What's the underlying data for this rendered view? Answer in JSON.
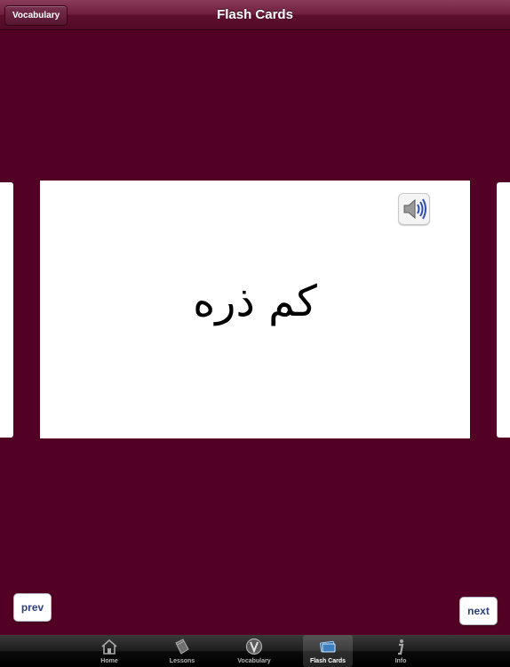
{
  "navbar": {
    "back_label": "Vocabulary",
    "title": "Flash Cards"
  },
  "card": {
    "word": "کم ذره",
    "speaker_icon": "speaker-icon"
  },
  "controls": {
    "prev_label": "prev",
    "next_label": "next"
  },
  "tabbar": {
    "tabs": [
      {
        "label": "Home",
        "icon": "home-icon",
        "selected": false
      },
      {
        "label": "Lessons",
        "icon": "book-icon",
        "selected": false
      },
      {
        "label": "Vocabulary",
        "icon": "vocabulary-icon",
        "selected": false
      },
      {
        "label": "Flash Cards",
        "icon": "flashcards-icon",
        "selected": true
      },
      {
        "label": "Info",
        "icon": "info-icon",
        "selected": false
      }
    ]
  },
  "colors": {
    "background": "#520023",
    "navbar": "#6e1e3c",
    "button_text": "#2c3f7e"
  }
}
